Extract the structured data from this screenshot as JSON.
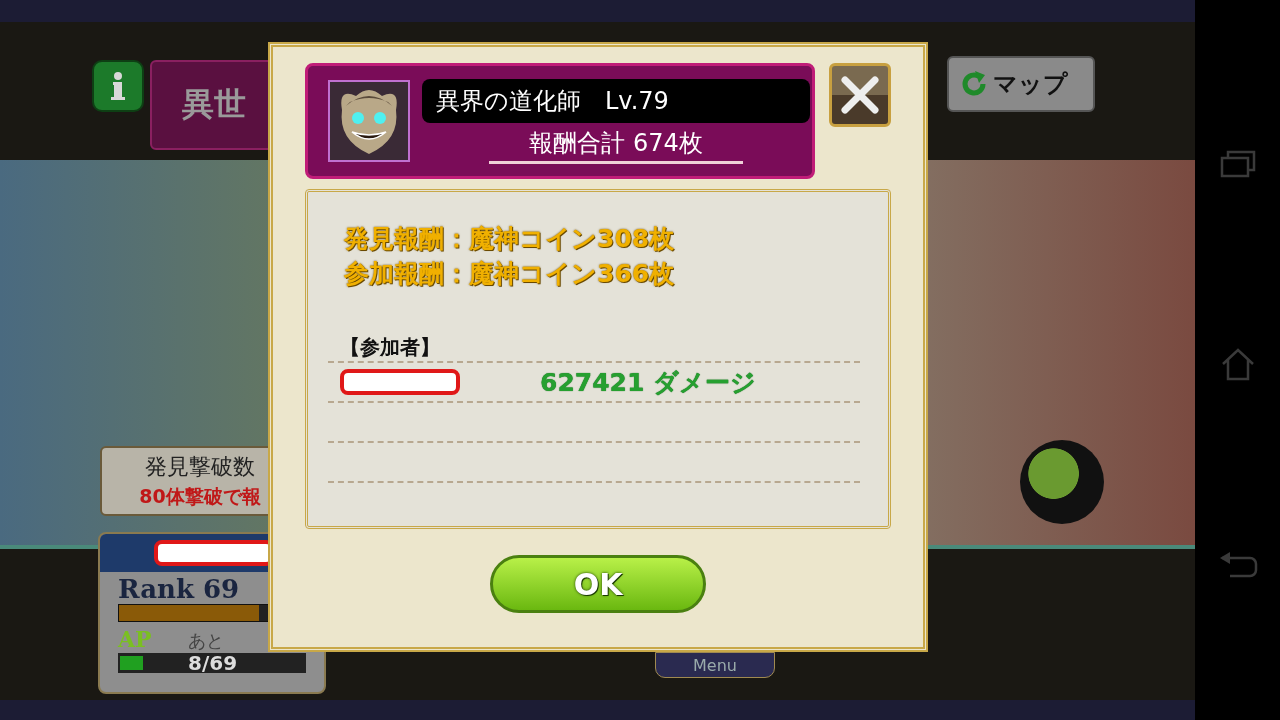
{
  "header": {
    "title": "異世",
    "map_button": "マップ"
  },
  "event_panel": {
    "title": "発見撃破数",
    "note": "80体撃破で報"
  },
  "player": {
    "rank": "Rank 69",
    "rank_bar": {
      "level": 0.75
    },
    "ap_label": "AP",
    "ap_note": "あと",
    "ap": "8/69",
    "ap_bar": {
      "level": 0.12
    }
  },
  "bottom_menu": "Menu",
  "dialog": {
    "boss_name": "異界の道化師　Lv.79",
    "reward_total": "報酬合計 674枚",
    "rewards": [
      "発見報酬：魔神コイン308枚",
      "参加報酬：魔神コイン366枚"
    ],
    "participants_heading": "【参加者】",
    "participants": [
      {
        "damage": "627421 ダメージ"
      }
    ],
    "ok_button": "OK"
  }
}
